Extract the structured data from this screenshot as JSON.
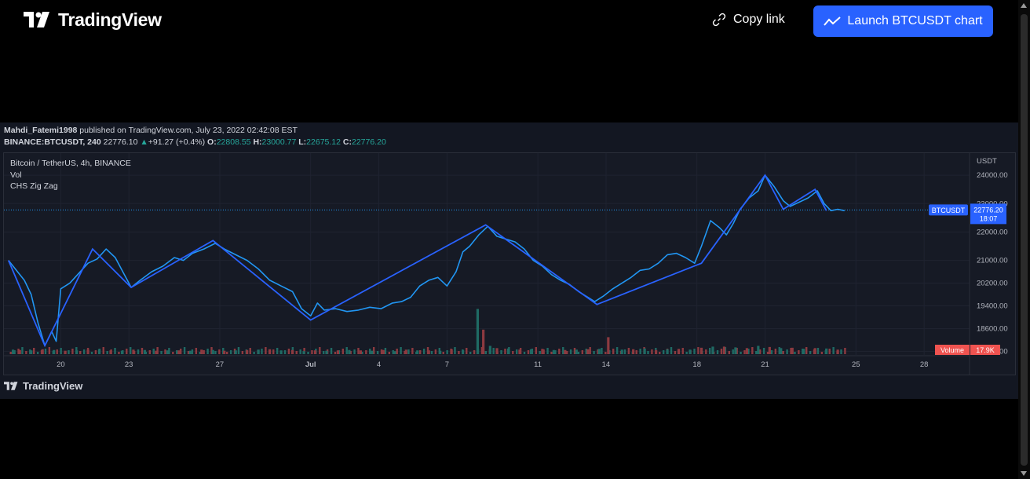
{
  "header": {
    "brand": "TradingView",
    "copy_link_label": "Copy link",
    "launch_label": "Launch BTCUSDT chart"
  },
  "widget": {
    "author": "Mahdi_Fatemi1998",
    "published_text": " published on TradingView.com, July 23, 2022 02:42:08 EST",
    "symbol": "BINANCE:BTCUSDT, 240",
    "last": "22776.10",
    "change": "+91.27 (+0.4%)",
    "o_label": "O:",
    "o": "22808.55",
    "h_label": "H:",
    "h": "23000.77",
    "l_label": "L:",
    "l": "22675.12",
    "c_label": "C:",
    "c": "22776.20",
    "legend_title": "Bitcoin / TetherUS, 4h, BINANCE",
    "legend_vol": "Vol",
    "legend_zigzag": "CHS Zig Zag",
    "footer_brand": "TradingView"
  },
  "chart_data": {
    "type": "line",
    "title": "Bitcoin / TetherUS, 4h, BINANCE",
    "y_unit": "USDT",
    "ylim": [
      17700,
      24500
    ],
    "y_ticks": [
      "24000.00",
      "23000.00",
      "22000.00",
      "21000.00",
      "20200.00",
      "19400.00",
      "18600.00",
      "17800.00"
    ],
    "x_ticks": [
      "20",
      "23",
      "27",
      "Jul",
      "4",
      "7",
      "11",
      "14",
      "18",
      "21",
      "25",
      "28"
    ],
    "x_tick_days": [
      20,
      23,
      27,
      31,
      34,
      37,
      41,
      44,
      48,
      51,
      55,
      58
    ],
    "price_label": "BTCUSDT",
    "price_value": "22776.20",
    "countdown": "18:07",
    "volume_label": "Volume",
    "volume_value": "17.9K",
    "current_price": 22776.2,
    "price_series": [
      [
        17.7,
        21000
      ],
      [
        18.0,
        20700
      ],
      [
        18.4,
        20300
      ],
      [
        18.7,
        19800
      ],
      [
        19.0,
        18800
      ],
      [
        19.3,
        18000
      ],
      [
        19.6,
        18500
      ],
      [
        19.8,
        18150
      ],
      [
        20.0,
        20000
      ],
      [
        20.4,
        20200
      ],
      [
        20.8,
        20550
      ],
      [
        21.2,
        20900
      ],
      [
        21.6,
        21050
      ],
      [
        22.0,
        21400
      ],
      [
        22.4,
        21100
      ],
      [
        22.8,
        20500
      ],
      [
        23.1,
        20050
      ],
      [
        23.5,
        20300
      ],
      [
        24.0,
        20600
      ],
      [
        24.5,
        20800
      ],
      [
        25.0,
        21100
      ],
      [
        25.4,
        21000
      ],
      [
        25.8,
        21250
      ],
      [
        26.3,
        21400
      ],
      [
        26.8,
        21600
      ],
      [
        27.2,
        21400
      ],
      [
        27.7,
        21200
      ],
      [
        28.2,
        21000
      ],
      [
        28.7,
        20700
      ],
      [
        29.2,
        20300
      ],
      [
        29.7,
        20100
      ],
      [
        30.2,
        19900
      ],
      [
        30.6,
        19300
      ],
      [
        31.0,
        19050
      ],
      [
        31.3,
        19500
      ],
      [
        31.6,
        19250
      ],
      [
        32.1,
        19300
      ],
      [
        32.6,
        19200
      ],
      [
        33.1,
        19250
      ],
      [
        33.6,
        19350
      ],
      [
        34.1,
        19300
      ],
      [
        34.6,
        19500
      ],
      [
        35.0,
        19550
      ],
      [
        35.4,
        19700
      ],
      [
        35.8,
        20100
      ],
      [
        36.2,
        20300
      ],
      [
        36.6,
        20400
      ],
      [
        37.0,
        20100
      ],
      [
        37.4,
        20600
      ],
      [
        37.7,
        21300
      ],
      [
        38.0,
        21500
      ],
      [
        38.4,
        21900
      ],
      [
        38.8,
        22200
      ],
      [
        39.2,
        21850
      ],
      [
        39.6,
        21750
      ],
      [
        40.0,
        21650
      ],
      [
        40.4,
        21400
      ],
      [
        40.8,
        21000
      ],
      [
        41.2,
        20800
      ],
      [
        41.6,
        20500
      ],
      [
        42.0,
        20300
      ],
      [
        42.4,
        20150
      ],
      [
        42.8,
        19900
      ],
      [
        43.2,
        19700
      ],
      [
        43.5,
        19550
      ],
      [
        43.9,
        19750
      ],
      [
        44.3,
        20000
      ],
      [
        44.7,
        20200
      ],
      [
        45.1,
        20400
      ],
      [
        45.5,
        20650
      ],
      [
        45.9,
        20700
      ],
      [
        46.3,
        20900
      ],
      [
        46.7,
        21200
      ],
      [
        47.1,
        21250
      ],
      [
        47.5,
        21100
      ],
      [
        47.9,
        20900
      ],
      [
        48.2,
        21500
      ],
      [
        48.6,
        22400
      ],
      [
        49.0,
        22150
      ],
      [
        49.3,
        21900
      ],
      [
        49.6,
        22300
      ],
      [
        49.9,
        22800
      ],
      [
        50.3,
        23200
      ],
      [
        50.7,
        23450
      ],
      [
        51.0,
        24000
      ],
      [
        51.4,
        23600
      ],
      [
        51.8,
        23100
      ],
      [
        52.1,
        22900
      ],
      [
        52.5,
        23050
      ],
      [
        52.9,
        23200
      ],
      [
        53.3,
        23450
      ],
      [
        53.6,
        23000
      ],
      [
        53.9,
        22750
      ],
      [
        54.2,
        22800
      ],
      [
        54.5,
        22750
      ]
    ],
    "zigzag": [
      [
        17.7,
        21000
      ],
      [
        19.3,
        18000
      ],
      [
        21.4,
        21400
      ],
      [
        23.1,
        20050
      ],
      [
        26.7,
        21700
      ],
      [
        31.0,
        18900
      ],
      [
        38.7,
        22250
      ],
      [
        43.6,
        19450
      ],
      [
        48.2,
        20900
      ],
      [
        51.0,
        24000
      ],
      [
        51.8,
        22800
      ],
      [
        53.2,
        23500
      ],
      [
        53.7,
        22750
      ]
    ],
    "volume_up": [
      [
        17.9,
        12
      ],
      [
        18.7,
        10
      ],
      [
        19.7,
        11
      ],
      [
        20.7,
        10
      ],
      [
        21.7,
        13
      ],
      [
        22.7,
        9
      ],
      [
        23.7,
        11
      ],
      [
        24.7,
        10
      ],
      [
        25.7,
        9
      ],
      [
        26.7,
        11
      ],
      [
        27.7,
        10
      ],
      [
        28.7,
        12
      ],
      [
        29.7,
        10
      ],
      [
        30.7,
        8
      ],
      [
        31.7,
        9
      ],
      [
        32.7,
        11
      ],
      [
        33.7,
        9
      ],
      [
        34.7,
        8
      ],
      [
        35.7,
        10
      ],
      [
        36.7,
        9
      ],
      [
        37.7,
        11
      ],
      [
        38.35,
        120
      ],
      [
        38.9,
        22
      ],
      [
        39.7,
        15
      ],
      [
        40.7,
        13
      ],
      [
        41.7,
        11
      ],
      [
        42.7,
        12
      ],
      [
        43.7,
        14
      ],
      [
        44.7,
        12
      ],
      [
        45.7,
        15
      ],
      [
        46.7,
        13
      ],
      [
        47.7,
        12
      ],
      [
        48.7,
        20
      ],
      [
        49.7,
        18
      ],
      [
        50.7,
        22
      ],
      [
        51.7,
        16
      ],
      [
        52.7,
        14
      ],
      [
        53.7,
        15
      ]
    ],
    "volume_down": [
      [
        18.2,
        11
      ],
      [
        19.2,
        13
      ],
      [
        20.2,
        9
      ],
      [
        21.2,
        12
      ],
      [
        22.2,
        10
      ],
      [
        23.2,
        12
      ],
      [
        24.2,
        9
      ],
      [
        25.2,
        10
      ],
      [
        26.2,
        12
      ],
      [
        27.2,
        9
      ],
      [
        28.2,
        11
      ],
      [
        29.2,
        13
      ],
      [
        30.2,
        11
      ],
      [
        31.2,
        10
      ],
      [
        32.2,
        10
      ],
      [
        33.2,
        10
      ],
      [
        34.2,
        11
      ],
      [
        35.2,
        12
      ],
      [
        36.2,
        10
      ],
      [
        37.2,
        13
      ],
      [
        38.6,
        65
      ],
      [
        39.2,
        16
      ],
      [
        40.2,
        12
      ],
      [
        41.2,
        14
      ],
      [
        42.2,
        11
      ],
      [
        43.2,
        13
      ],
      [
        44.1,
        45
      ],
      [
        45.2,
        13
      ],
      [
        46.2,
        11
      ],
      [
        47.2,
        14
      ],
      [
        48.2,
        17
      ],
      [
        49.2,
        20
      ],
      [
        50.2,
        16
      ],
      [
        51.2,
        19
      ],
      [
        52.2,
        17
      ],
      [
        53.2,
        16
      ],
      [
        54.2,
        12
      ]
    ],
    "colors": {
      "price_line": "#2196f3",
      "zigzag": "#2962ff",
      "vol_up": "#1f6a64",
      "vol_down": "#8d3a40",
      "accent": "#2962ff",
      "volume_badge": "#ef5350"
    }
  }
}
